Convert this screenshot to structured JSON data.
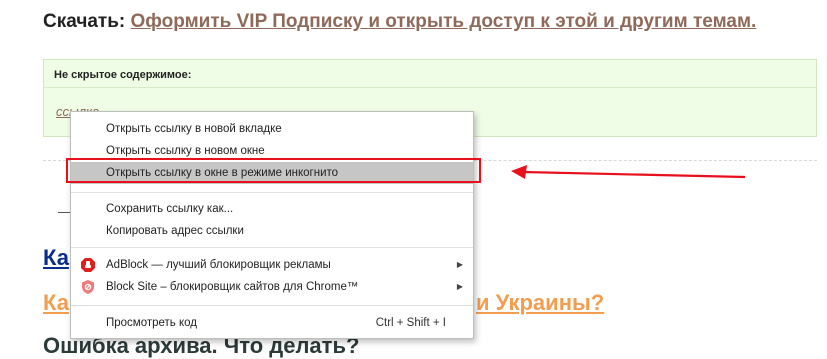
{
  "download": {
    "label": "Скачать:",
    "link_text": "Оформить VIP Подписку и открыть доступ к этой и другим темам."
  },
  "hidden_box": {
    "header": "Не скрытое содержимое:",
    "link_text": "ссылка"
  },
  "background_headings": {
    "blue_fragment": "Ка",
    "orange_fragment": "Ка",
    "orange_tail": "и Украины?",
    "dark_heading": "Ошибка архива. Что делать?"
  },
  "context_menu": {
    "items": [
      {
        "label": "Открыть ссылку в новой вкладке"
      },
      {
        "label": "Открыть ссылку в новом окне"
      },
      {
        "label": "Открыть ссылку в окне в режиме инкогнито"
      },
      {
        "label": "Сохранить ссылку как..."
      },
      {
        "label": "Копировать адрес ссылки"
      },
      {
        "label": "AdBlock — лучший блокировщик рекламы",
        "icon": "adblock-icon"
      },
      {
        "label": "Block Site – блокировщик сайтов для Chrome™",
        "icon": "blocksite-icon"
      },
      {
        "label": "Просмотреть код",
        "shortcut": "Ctrl + Shift + I"
      }
    ],
    "highlighted_index": 2
  },
  "colors": {
    "annotation_red": "#e8101c",
    "link_brown": "#8f6a5a",
    "heading_orange": "#f29d50",
    "heading_blue": "#0a2d8c",
    "box_green": "#f0fde6"
  }
}
